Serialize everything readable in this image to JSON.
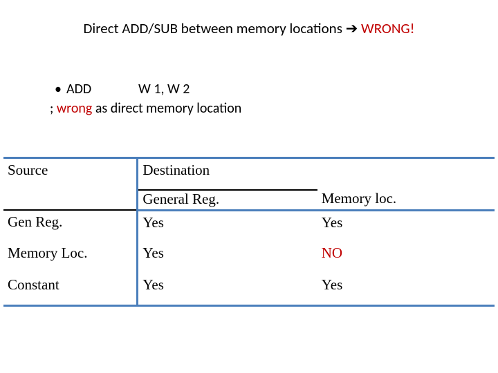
{
  "title": {
    "prefix": "Direct ADD/SUB between memory locations ",
    "arrow": "➔",
    "wrong": " WRONG!"
  },
  "body": {
    "bullet_add": "ADD",
    "bullet_args": "W 1, W 2",
    "line2_prefix": "; ",
    "line2_wrong": "wrong",
    "line2_rest": " as direct memory location"
  },
  "table": {
    "headers": {
      "source": "Source",
      "destination": "Destination",
      "general_reg": "General Reg.",
      "memory_loc": "Memory loc."
    },
    "rows": [
      {
        "label": "Gen Reg.",
        "gen": "Yes",
        "mem": "Yes",
        "mem_class": ""
      },
      {
        "label": "Memory Loc.",
        "gen": "Yes",
        "mem": "NO",
        "mem_class": "no-red"
      },
      {
        "label": "Constant",
        "gen": "Yes",
        "mem": "Yes",
        "mem_class": ""
      }
    ]
  },
  "chart_data": {
    "type": "table",
    "title": "Direct ADD/SUB between memory locations → WRONG!",
    "columns": [
      "Source",
      "Destination: General Reg.",
      "Destination: Memory loc."
    ],
    "rows": [
      [
        "Gen Reg.",
        "Yes",
        "Yes"
      ],
      [
        "Memory Loc.",
        "Yes",
        "NO"
      ],
      [
        "Constant",
        "Yes",
        "Yes"
      ]
    ]
  }
}
